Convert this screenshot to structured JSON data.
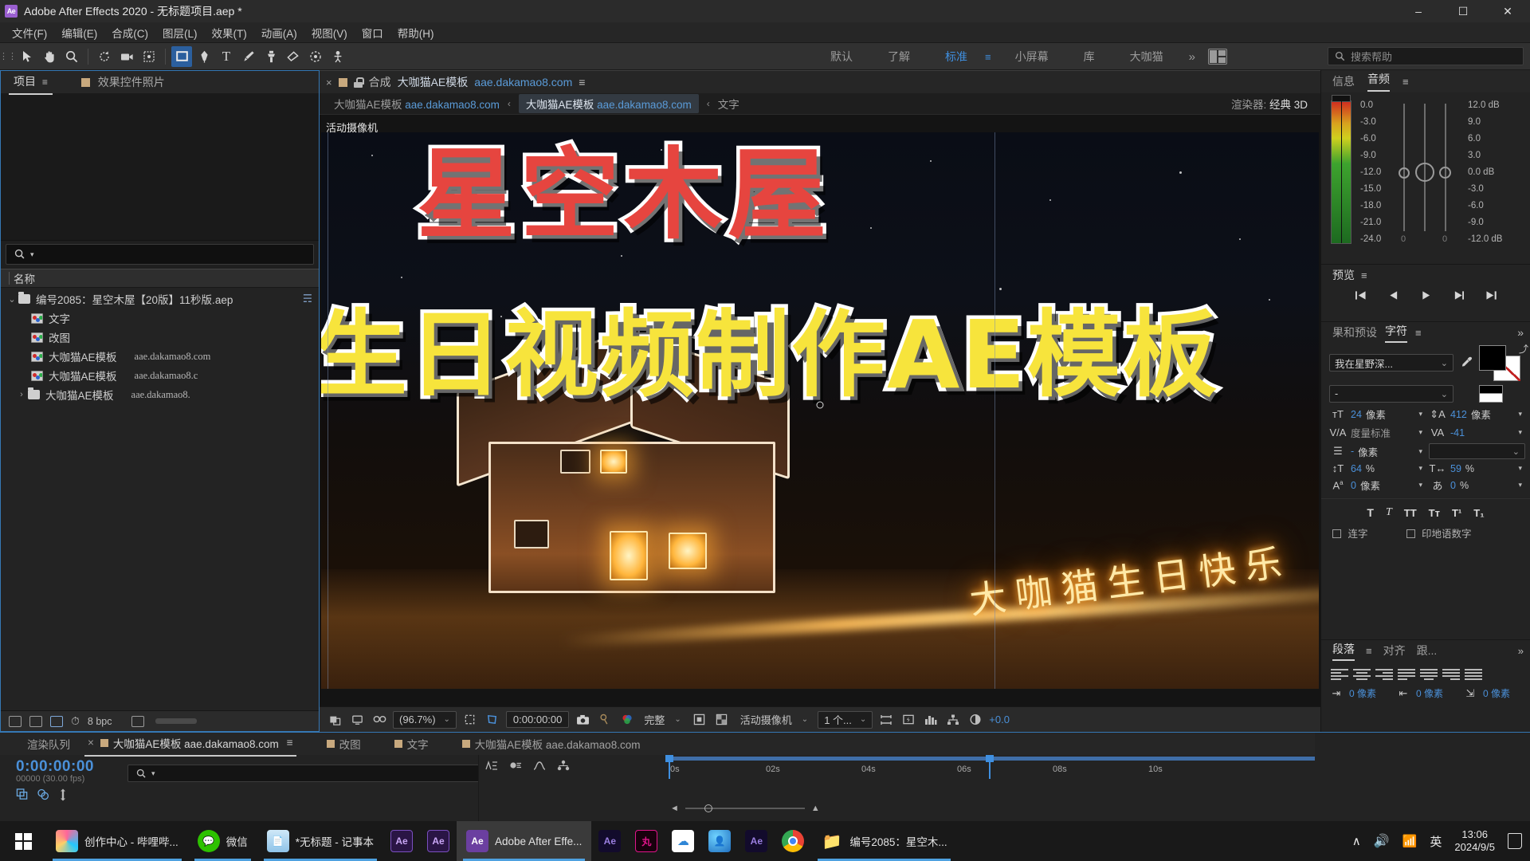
{
  "titlebar": {
    "app_icon": "ae-logo-icon",
    "title": "Adobe After Effects 2020 - 无标题项目.aep *",
    "minimize": "–",
    "maximize": "☐",
    "close": "✕"
  },
  "menubar": {
    "items": [
      "文件(F)",
      "编辑(E)",
      "合成(C)",
      "图层(L)",
      "效果(T)",
      "动画(A)",
      "视图(V)",
      "窗口",
      "帮助(H)"
    ]
  },
  "toolbar": {
    "tools": [
      {
        "name": "home-icon",
        "glyph": "☰"
      },
      {
        "name": "selection-tool",
        "glyph": "▶"
      },
      {
        "name": "hand-tool",
        "glyph": "✋"
      },
      {
        "name": "zoom-tool",
        "glyph": "⚲"
      },
      {
        "name": "rotation-tool",
        "glyph": "↻"
      },
      {
        "name": "camera-tool",
        "glyph": "⬛"
      },
      {
        "name": "anchor-point-tool",
        "glyph": "⌗"
      },
      {
        "name": "shape-tool",
        "glyph": "■"
      },
      {
        "name": "pen-tool",
        "glyph": "✒"
      },
      {
        "name": "type-tool",
        "glyph": "T"
      },
      {
        "name": "brush-tool",
        "glyph": "✎"
      },
      {
        "name": "clone-stamp-tool",
        "glyph": "⎙"
      },
      {
        "name": "eraser-tool",
        "glyph": "▭"
      },
      {
        "name": "roto-brush-tool",
        "glyph": "☂"
      },
      {
        "name": "puppet-tool",
        "glyph": "✤"
      }
    ],
    "workspaces": [
      "默认",
      "了解",
      "标准",
      "小屏幕",
      "库",
      "大咖猫"
    ],
    "workspace_active": "标准",
    "workspace_menu_icon": "hamburger-icon",
    "overflow_icon": "»",
    "layout_icon": "workspace-layout-icon",
    "help_placeholder": "搜索帮助",
    "help_icon": "search-icon"
  },
  "project_panel": {
    "tabs": [
      {
        "label": "项目",
        "active": true,
        "menu": "≡"
      },
      {
        "label": "效果控件照片",
        "active": false,
        "swatch": true
      }
    ],
    "search_placeholder": "",
    "search_icon": "search-icon",
    "column_header": "名称",
    "items": [
      {
        "indent": 0,
        "twisty": "⌄",
        "icon": "folder-icon",
        "name": "编号2085：星空木屋【20版】11秒版.aep",
        "sub": "",
        "badge": "☴"
      },
      {
        "indent": 1,
        "twisty": "",
        "icon": "composition-icon",
        "name": "文字",
        "sub": ""
      },
      {
        "indent": 1,
        "twisty": "",
        "icon": "composition-icon",
        "name": "改图",
        "sub": ""
      },
      {
        "indent": 1,
        "twisty": "",
        "icon": "composition-icon",
        "name": "大咖猫AE模板",
        "sub": "aae.dakamao8.com"
      },
      {
        "indent": 1,
        "twisty": "",
        "icon": "composition-icon",
        "name": "大咖猫AE模板",
        "sub": "aae.dakamao8.c"
      },
      {
        "indent": 0,
        "twisty": "›",
        "icon": "folder-icon",
        "name": "大咖猫AE模板",
        "sub": "aae.dakamao8."
      }
    ],
    "footer": {
      "bit_depth": "8 bpc",
      "icons": [
        "new-folder-icon",
        "new-composition-icon",
        "project-settings-icon",
        "delete-icon"
      ]
    }
  },
  "composition": {
    "tab": {
      "close": "×",
      "swatch_color": "#c8a97e",
      "lock_icon": "lock-icon",
      "prefix": "合成",
      "name_cn": "大咖猫AE模板",
      "name_url": "aae.dakamao8.com",
      "menu": "≡"
    },
    "breadcrumbs": [
      {
        "cn": "大咖猫AE模板",
        "url": "aae.dakamao8.com",
        "selected": false
      },
      {
        "cn": "大咖猫AE模板",
        "url": "aae.dakamao8.com",
        "selected": true
      },
      {
        "cn": "文字",
        "url": "",
        "selected": false
      }
    ],
    "breadcrumb_arrow": "‹",
    "renderer_label": "渲染器:",
    "renderer_value": "经典 3D",
    "camera_label": "活动摄像机",
    "artwork": {
      "title_red": "星空木屋",
      "title_yellow": "生日视频制作AE模板",
      "neon_text": "大咖猫生日快乐"
    },
    "bottom_bar": {
      "zoom": "(96.7%)",
      "time": "0:00:00:00",
      "quality": "完整",
      "view": "活动摄像机",
      "views_count": "1 个...",
      "exposure": "+0.0",
      "icons": [
        "toggle-mask-icon",
        "toggle-transparency-icon",
        "3d-glasses-icon",
        "region-of-interest-icon",
        "grid-guides-icon",
        "snapshot-icon",
        "show-snapshot-icon",
        "channel-icon",
        "resolution-icon",
        "transparency-grid-icon",
        "timeline-icon",
        "fast-preview-icon",
        "renderer-options-icon",
        "flowchart-icon",
        "exposure-icon"
      ]
    }
  },
  "right_panel": {
    "info_audio": {
      "tabs": [
        "信息",
        "音频"
      ],
      "active_tab": "音频",
      "menu": "≡",
      "meter_scale": [
        "0.0",
        "-3.0",
        "-6.0",
        "-9.0",
        "-12.0",
        "-15.0",
        "-18.0",
        "-21.0",
        "-24.0"
      ],
      "db_scale": [
        "12.0 dB",
        "9.0",
        "6.0",
        "3.0",
        "0.0 dB",
        "-3.0",
        "-6.0",
        "-9.0",
        "-12.0 dB"
      ],
      "fader_values": [
        "0",
        "0"
      ]
    },
    "preview": {
      "title": "预览",
      "menu": "≡",
      "buttons": [
        "first-frame-icon",
        "previous-frame-icon",
        "play-icon",
        "next-frame-icon",
        "last-frame-icon"
      ]
    },
    "character": {
      "tabs": [
        "果和预设",
        "字符"
      ],
      "active_tab": "字符",
      "menu": "≡",
      "more": "»",
      "font_family": "我在星野深...",
      "font_style": "-",
      "eyedropper_icon": "eyedropper-icon",
      "metrics": [
        {
          "icon": "font-size-icon",
          "name": "font-size",
          "value": "24",
          "unit": "像素",
          "caret": "▾"
        },
        {
          "icon": "leading-icon",
          "name": "leading",
          "value": "412",
          "unit": "像素",
          "caret": "▾"
        },
        {
          "icon": "kerning-icon",
          "name": "kerning",
          "value": "度量标准",
          "unit": "",
          "dim": true,
          "caret": "▾"
        },
        {
          "icon": "tracking-icon",
          "name": "tracking",
          "value": "-41",
          "unit": "",
          "caret": "▾"
        },
        {
          "icon": "stroke-width-icon",
          "name": "stroke-width",
          "value": "-",
          "unit": "像素",
          "dim": true,
          "caret": "▾"
        },
        {
          "icon": "vertical-scale-icon",
          "name": "vertical-scale",
          "value": "64",
          "unit": "%",
          "caret": "▾"
        },
        {
          "icon": "horizontal-scale-icon",
          "name": "horizontal-scale",
          "value": "59",
          "unit": "%",
          "caret": "▾"
        },
        {
          "icon": "baseline-shift-icon",
          "name": "baseline-shift",
          "value": "0",
          "unit": "像素",
          "caret": "▾"
        },
        {
          "icon": "tsume-icon",
          "name": "tsume",
          "value": "0",
          "unit": "%",
          "caret": "▾"
        }
      ],
      "style_buttons": [
        "T",
        "T",
        "TT",
        "Tт",
        "T¹",
        "T₁"
      ],
      "checkboxes": [
        {
          "label": "连字",
          "checked": false
        },
        {
          "label": "印地语数字",
          "checked": false
        }
      ]
    },
    "paragraph": {
      "tabs": [
        "段落",
        "对齐",
        "跟..."
      ],
      "active_tab": "段落",
      "menu": "≡",
      "more": "»",
      "values": [
        "0 像素",
        "0 像素",
        "0 像素"
      ]
    }
  },
  "timeline": {
    "tabs": [
      {
        "label": "渲染队列",
        "active": false,
        "swatch": false,
        "close": false
      },
      {
        "label": "大咖猫AE模板  aae.dakamao8.com",
        "active": true,
        "swatch": true,
        "close": true,
        "menu": "≡"
      },
      {
        "label": "改图",
        "active": false,
        "swatch": true
      },
      {
        "label": "文字",
        "active": false,
        "swatch": true
      },
      {
        "label": "大咖猫AE模板  aae.dakamao8.com",
        "active": false,
        "swatch": true
      }
    ],
    "current_time": "0:00:00:00",
    "time_sub": "00000 (30.00 fps)",
    "search_placeholder": "",
    "search_icon": "search-icon",
    "switch_icons": [
      "composition-mini-flowchart-icon",
      "draft-3d-icon",
      "hide-shy-layers-icon"
    ],
    "graph_icons": [
      "frame-blend-icon",
      "motion-blur-icon",
      "graph-editor-icon",
      "brainstorm-icon"
    ],
    "ruler_ticks": [
      "0s",
      "02s",
      "04s",
      "06s",
      "08s",
      "10s"
    ]
  },
  "taskbar": {
    "start_icon": "windows-logo-icon",
    "items": [
      {
        "label": "创作中心 - 哔哩哔...",
        "icon": "bilibili-icon",
        "color": "#fb7299",
        "active": false,
        "running": true
      },
      {
        "label": "微信",
        "icon": "wechat-icon",
        "color": "#2dc100",
        "active": false,
        "running": true
      },
      {
        "label": "*无标题 - 记事本",
        "icon": "notepad-icon",
        "color": "#7fb8e0",
        "active": false,
        "running": true
      },
      {
        "label": "",
        "icon": "ae-icon",
        "color": "#4a2a6b",
        "active": false,
        "running": false
      },
      {
        "label": "",
        "icon": "ae-icon",
        "color": "#4a2a6b",
        "active": false,
        "running": false
      },
      {
        "label": "Adobe After Effe...",
        "icon": "ae-icon",
        "color": "#6b3fa0",
        "active": true,
        "running": true
      },
      {
        "label": "",
        "icon": "ae-icon",
        "color": "#1d1040",
        "active": false,
        "running": false
      },
      {
        "label": "",
        "icon": "wan-icon",
        "color": "#e0158a",
        "active": false,
        "running": false
      },
      {
        "label": "",
        "icon": "cloud-icon",
        "color": "#ffffff",
        "active": false,
        "running": false
      },
      {
        "label": "",
        "icon": "meeting-icon",
        "color": "#2b8ad0",
        "active": false,
        "running": false
      },
      {
        "label": "",
        "icon": "ae-icon",
        "color": "#1d1040",
        "active": false,
        "running": false
      },
      {
        "label": "",
        "icon": "chrome-icon",
        "color": "#ffffff",
        "active": false,
        "running": false
      },
      {
        "label": "编号2085：星空木...",
        "icon": "folder-icon",
        "color": "#f5cf6b",
        "active": false,
        "running": true
      }
    ],
    "tray": {
      "chevron": "∧",
      "volume_icon": "volume-icon",
      "wifi_icon": "wifi-icon",
      "ime": "英",
      "time": "13:06",
      "date": "2024/9/5",
      "notification_icon": "notification-icon"
    }
  }
}
